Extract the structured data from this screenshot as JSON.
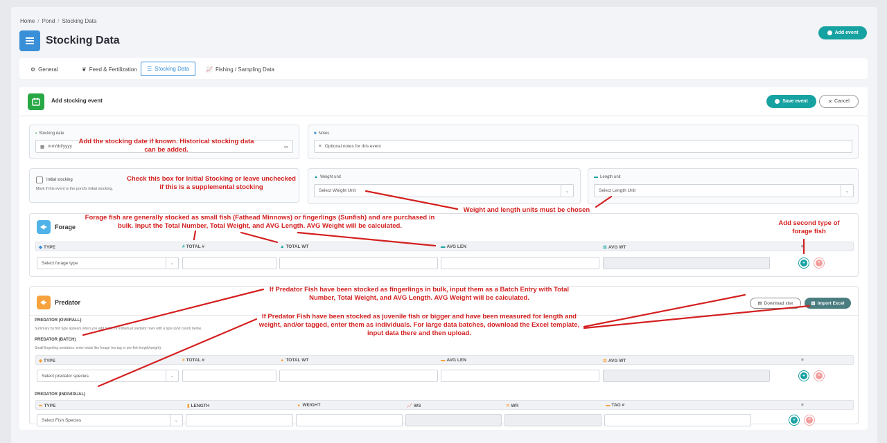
{
  "breadcrumb": [
    "Home",
    "Pond",
    "Stocking Data"
  ],
  "page_title": "Stocking Data",
  "add_event_label": "Add event",
  "tabs": [
    {
      "label": "General",
      "icon": "gear-icon"
    },
    {
      "label": "Feed & Fertilization",
      "icon": "leaf-icon"
    },
    {
      "label": "Stocking Data",
      "icon": "list-icon",
      "active": true
    },
    {
      "label": "Fishing / Sampling Data",
      "icon": "chart-icon"
    }
  ],
  "form": {
    "title": "Add stocking event",
    "save_label": "Save event",
    "cancel_label": "Cancel",
    "stocking_date_label": "Stocking date",
    "stocking_date_value": "mm/dd/yyyy",
    "notes_label": "Notes",
    "notes_placeholder": "Optional notes for this event",
    "initial_label": "Initial stocking",
    "initial_help": "Mark if this event is the pond's initial stocking.",
    "weight_unit_label": "Weight unit",
    "weight_unit_value": "Select Weight Unit",
    "length_unit_label": "Length unit",
    "length_unit_value": "Select Length Unit"
  },
  "forage": {
    "title": "Forage",
    "columns": [
      "TYPE",
      "TOTAL #",
      "TOTAL WT",
      "AVG LEN",
      "AVG WT"
    ],
    "type_placeholder": "Select forage type"
  },
  "predator": {
    "title": "Predator",
    "download_label": "Download xlsx",
    "import_label": "Import Excel",
    "overall_head": "PREDATOR (OVERALL)",
    "overall_help": "Summary by fish type appears when you add batch or individual predator rows with a type (and count) below.",
    "batch_head": "PREDATOR (BATCH)",
    "batch_help": "Small fingerling predators: enter totals like forage (no tag or per-fish length/weight).",
    "batch_columns": [
      "TYPE",
      "TOTAL #",
      "TOTAL WT",
      "AVG LEN",
      "AVG WT"
    ],
    "batch_type_placeholder": "Select predator species",
    "individual_head": "PREDATOR (INDIVIDUAL)",
    "individual_columns": [
      "TYPE",
      "LENGTH",
      "WEIGHT",
      "WS",
      "WR",
      "TAG #"
    ],
    "individual_type_placeholder": "Select Fish Species"
  },
  "annotations": {
    "date_line1": "Add the stocking date if known. Historical stocking data",
    "date_line2": "can be added.",
    "initial_line1": "Check this box for Initial Stocking or leave unchecked",
    "initial_line2": "if this is a supplemental stocking",
    "units": "Weight and length units must be chosen",
    "forage_line1": "Forage fish are generally stocked as small fish (Fathead Minnows) or fingerlings (Sunfish) and are purchased in",
    "forage_line2": "bulk. Input the Total Number, Total Weight, and AVG Length. AVG Weight will be calculated.",
    "second_line1": "Add second type of",
    "second_line2": "forage fish",
    "batch_line1": "If Predator Fish have been stocked as fingerlings in bulk, input them as a Batch Entry with Total",
    "batch_line2": "Number, Total Weight, and AVG Length. AVG Weight will be calculated.",
    "indiv_line1": "If Predator Fish have been stocked as juvenile fish or bigger and have been measured for length and",
    "indiv_line2": "weight, and/or tagged, enter them as individuals. For large data batches, download the Excel template,",
    "indiv_line3": "input data there and then upload."
  },
  "colors": {
    "accent": "#17a2a2",
    "primary_blue": "#3a8fd9",
    "annotation_red": "#d42020",
    "success_green": "#28a745",
    "forage_icon": "#4fb3e8",
    "predator_icon": "#f7a23c"
  }
}
